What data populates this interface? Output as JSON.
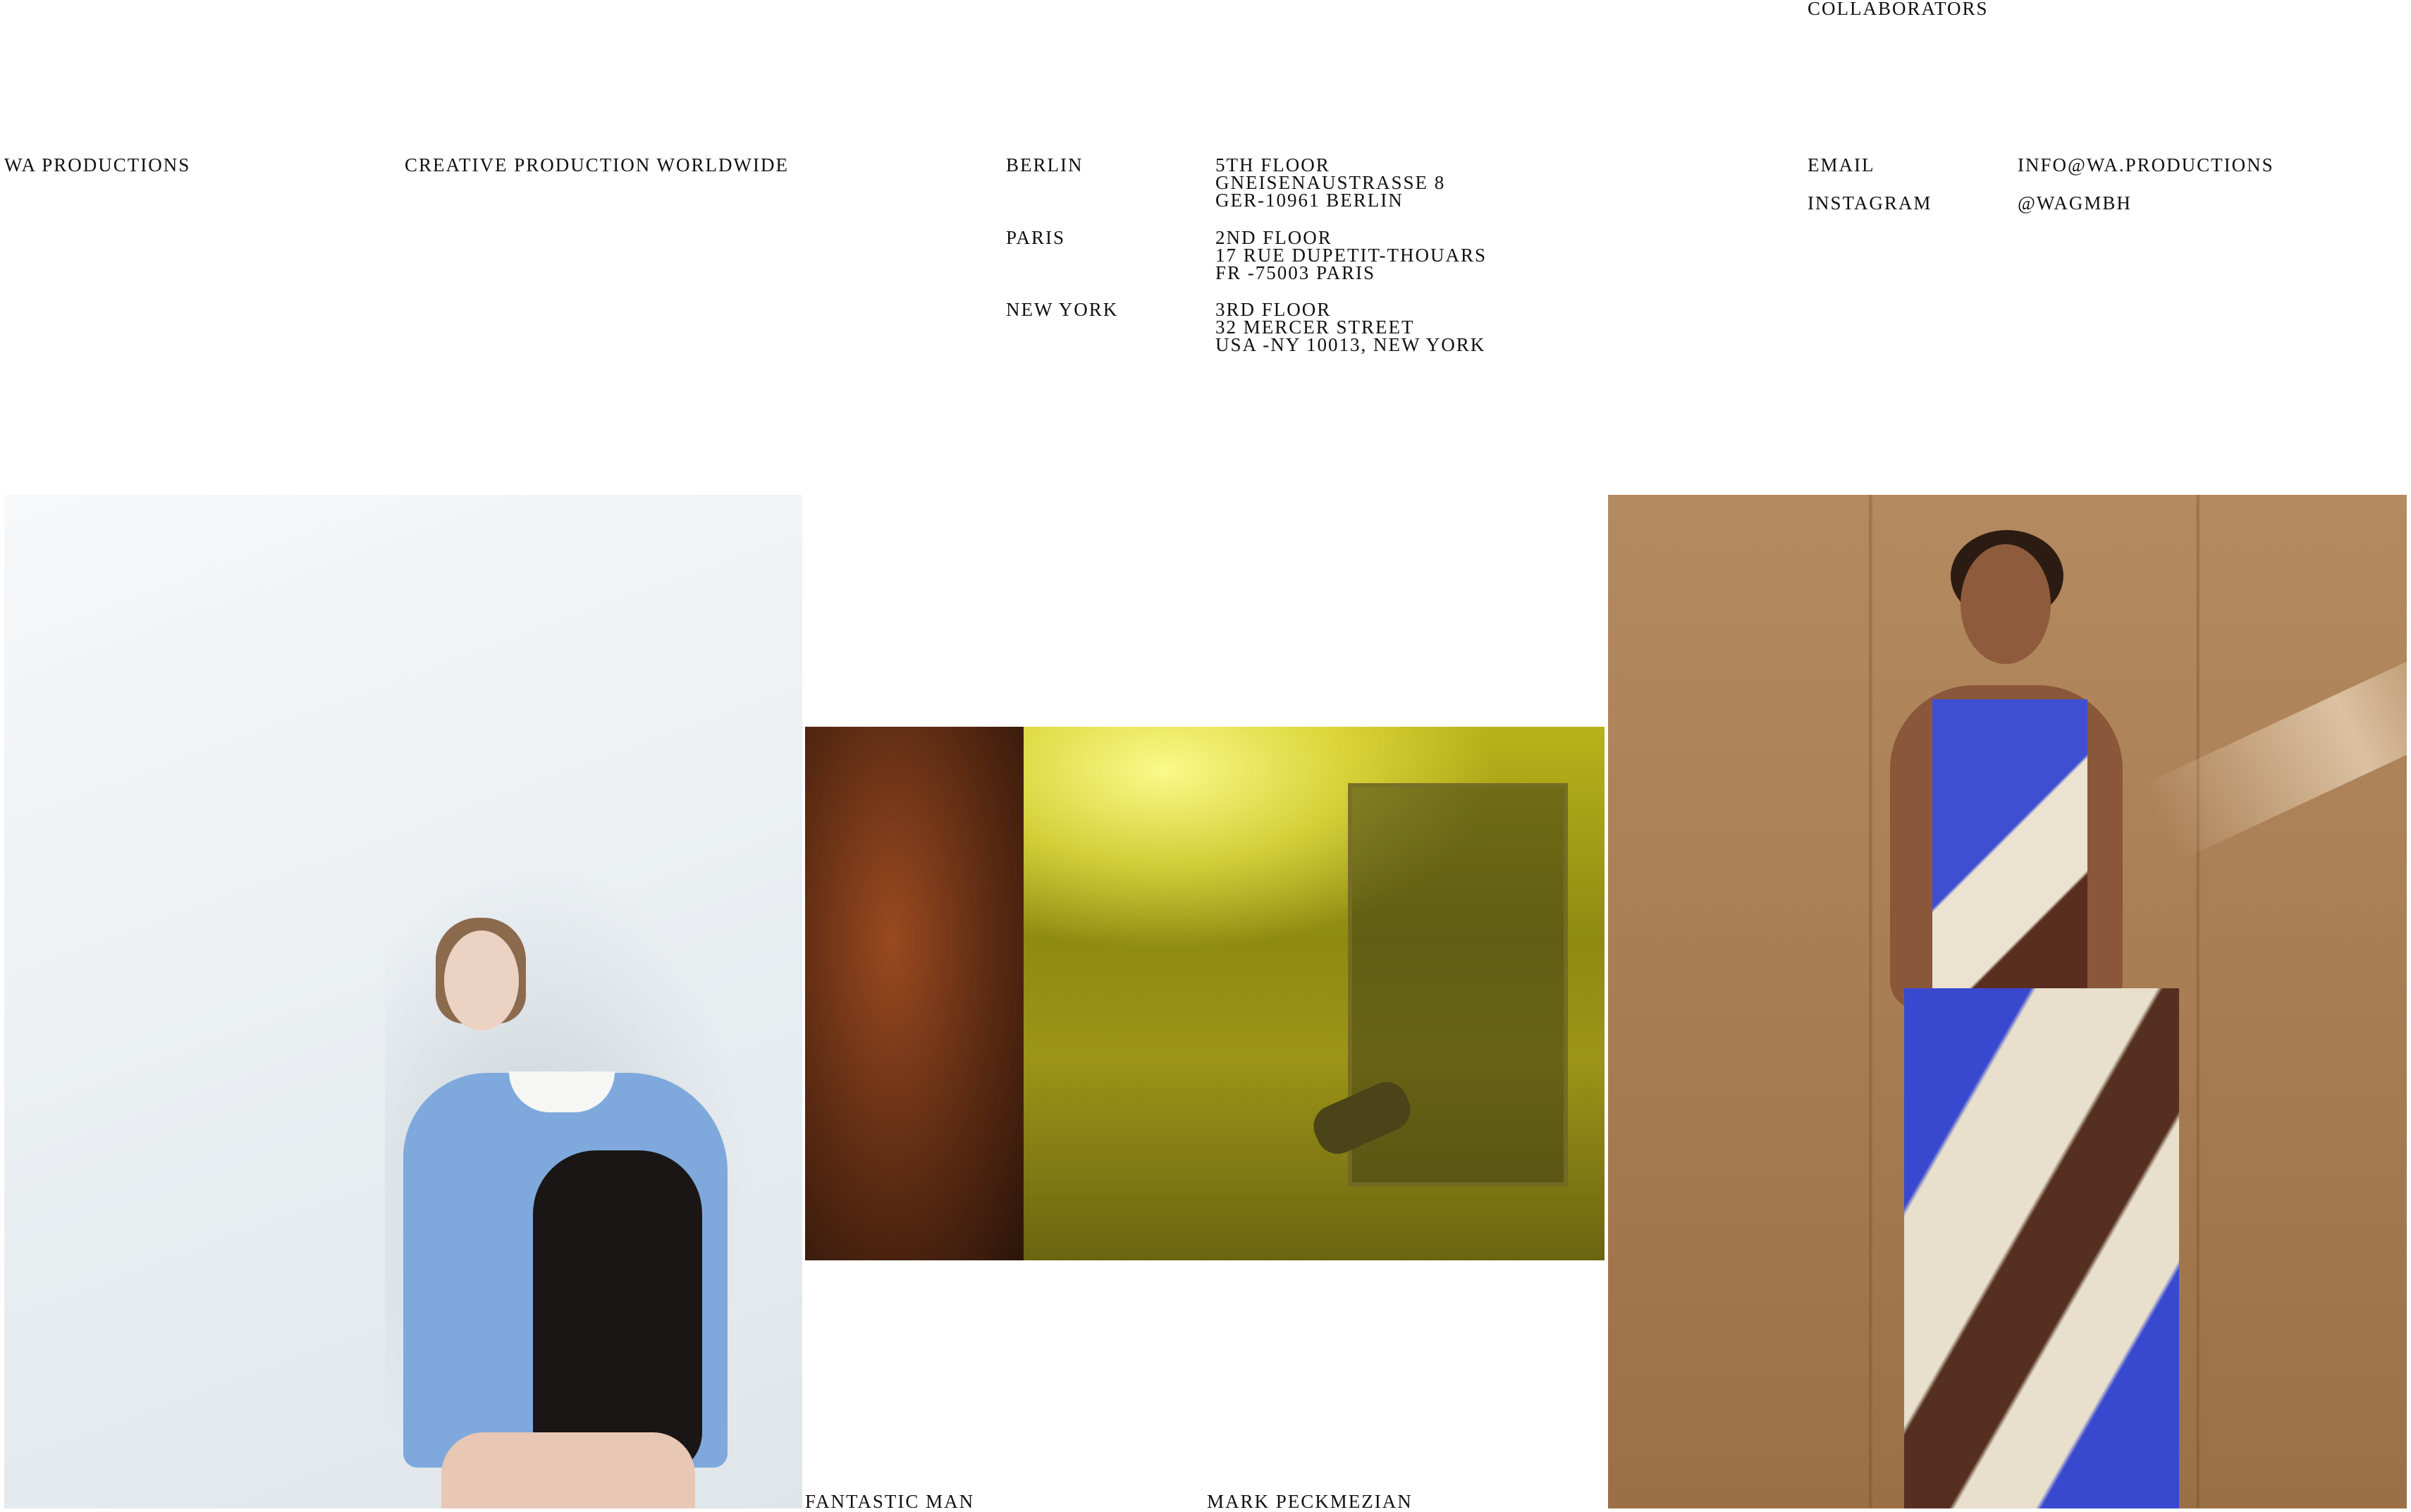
{
  "header": {
    "collaborators": "COLLABORATORS",
    "brand": "WA PRODUCTIONS",
    "tagline": "CREATIVE PRODUCTION WORLDWIDE"
  },
  "offices": [
    {
      "city": "BERLIN",
      "lines": [
        "5TH FLOOR",
        "GNEISENAUSTRASSE 8",
        "GER-10961 BERLIN"
      ]
    },
    {
      "city": "PARIS",
      "lines": [
        "2ND FLOOR",
        "17 RUE DUPETIT-THOUARS",
        "FR -75003 PARIS"
      ]
    },
    {
      "city": "NEW YORK",
      "lines": [
        "3RD FLOOR",
        "32 MERCER STREET",
        "USA -NY 10013, NEW YORK"
      ]
    }
  ],
  "contact": {
    "email_label": "EMAIL",
    "email_value": "INFO@WA.PRODUCTIONS",
    "instagram_label": "INSTAGRAM",
    "instagram_value": "@WAGMBH"
  },
  "captions": {
    "fantastic_man": "FANTASTIC MAN",
    "mark_peckmezian": "MARK PECKMEZIAN"
  },
  "colors": {
    "text": "#111111",
    "background": "#ffffff"
  }
}
